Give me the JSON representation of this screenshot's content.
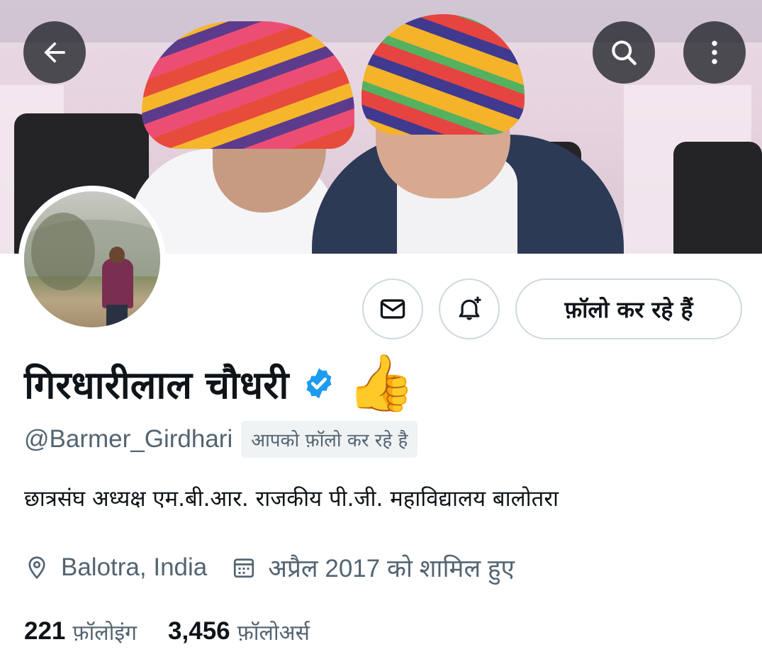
{
  "profile": {
    "display_name": "गिरधारीलाल चौधरी",
    "emoji": "👍",
    "handle": "@Barmer_Girdhari",
    "follows_you_label": "आपको फ़ॉलो कर रहे है",
    "bio": "छात्रसंघ अध्यक्ष एम.बी.आर. राजकीय पी.जी. महाविद्यालय बालोतरा",
    "location": "Balotra, India",
    "joined": "अप्रैल 2017 को शामिल हुए",
    "verified": true
  },
  "stats": {
    "following_count": "221",
    "following_label": "फ़ॉलोइंग",
    "followers_count": "3,456",
    "followers_label": "फ़ॉलोअर्स"
  },
  "actions": {
    "follow_label": "फ़ॉलो कर रहे हैं"
  },
  "icons": {
    "back": "arrow-left-icon",
    "search": "search-icon",
    "more": "more-vertical-icon",
    "message": "mail-icon",
    "notify": "bell-plus-icon",
    "location": "location-pin-icon",
    "calendar": "calendar-icon",
    "verified": "verified-badge-icon"
  },
  "colors": {
    "text_primary": "#0f1419",
    "text_secondary": "#536471",
    "border": "#cfd9de",
    "verified_blue": "#1d9bf0",
    "chip_bg": "#eff3f4"
  }
}
